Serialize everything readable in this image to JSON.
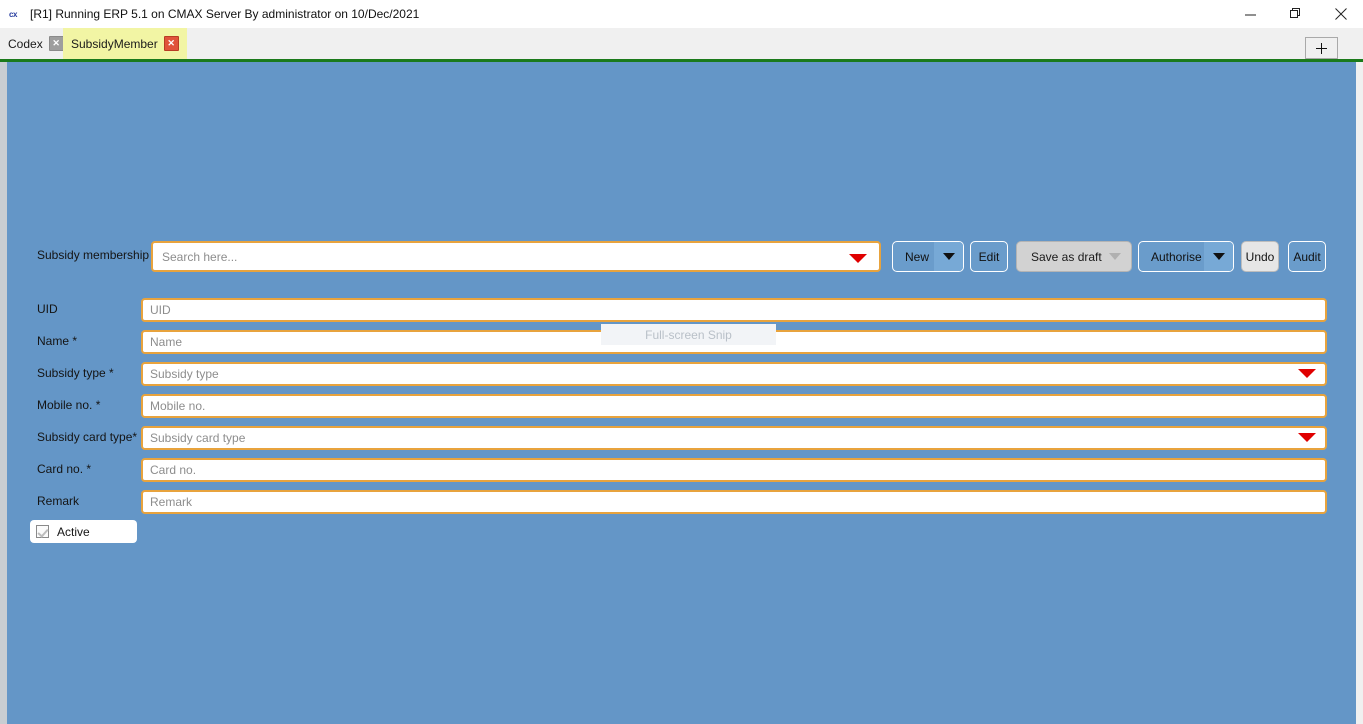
{
  "window": {
    "icon_text": "cx",
    "title": "[R1] Running ERP 5.1 on CMAX Server By administrator on 10/Dec/2021",
    "controls": {
      "minimize": "minimize-icon",
      "restore": "restore-icon",
      "close": "close-icon"
    }
  },
  "tabs": {
    "items": [
      {
        "label": "Codex",
        "close": "✕",
        "active": false
      },
      {
        "label": "SubsidyMember",
        "close": "✕",
        "active": true
      }
    ],
    "new_tab": "+"
  },
  "toolbar": {
    "search_label": "Subsidy membership",
    "search_placeholder": "Search here...",
    "search_value": "",
    "buttons": [
      {
        "label": "New",
        "state": "enabled",
        "has_dropdown": true
      },
      {
        "label": "Edit",
        "state": "enabled",
        "has_dropdown": false
      },
      {
        "label": "Save as draft",
        "state": "disabled",
        "has_dropdown": true
      },
      {
        "label": "Authorise",
        "state": "enabled",
        "has_dropdown": true
      },
      {
        "label": "Undo",
        "state": "enabled",
        "has_dropdown": false
      },
      {
        "label": "Audit",
        "state": "enabled",
        "has_dropdown": false
      }
    ]
  },
  "form": {
    "fields": [
      {
        "label": "UID",
        "placeholder": "UID",
        "value": "",
        "type": "text"
      },
      {
        "label": "Name *",
        "placeholder": "Name",
        "value": "",
        "type": "text"
      },
      {
        "label": "Subsidy type *",
        "placeholder": "Subsidy type",
        "value": "",
        "type": "dropdown"
      },
      {
        "label": "Mobile no. *",
        "placeholder": "Mobile no.",
        "value": "",
        "type": "text"
      },
      {
        "label": "Subsidy card type*",
        "placeholder": "Subsidy card type",
        "value": "",
        "type": "dropdown"
      },
      {
        "label": "Card no. *",
        "placeholder": "Card no.",
        "value": "",
        "type": "text"
      },
      {
        "label": "Remark",
        "placeholder": "Remark",
        "value": "",
        "type": "text"
      }
    ],
    "active_checkbox": {
      "label": "Active",
      "checked": true,
      "enabled": false
    }
  },
  "overlay": {
    "snip_label": "Full-screen Snip"
  },
  "colors": {
    "panel_blue": "#6496c7",
    "field_border_orange": "#e8a33d",
    "caret_red": "#e00000",
    "tab_active_yellow": "#f2f5a4",
    "rule_green": "#1b7a1b"
  }
}
